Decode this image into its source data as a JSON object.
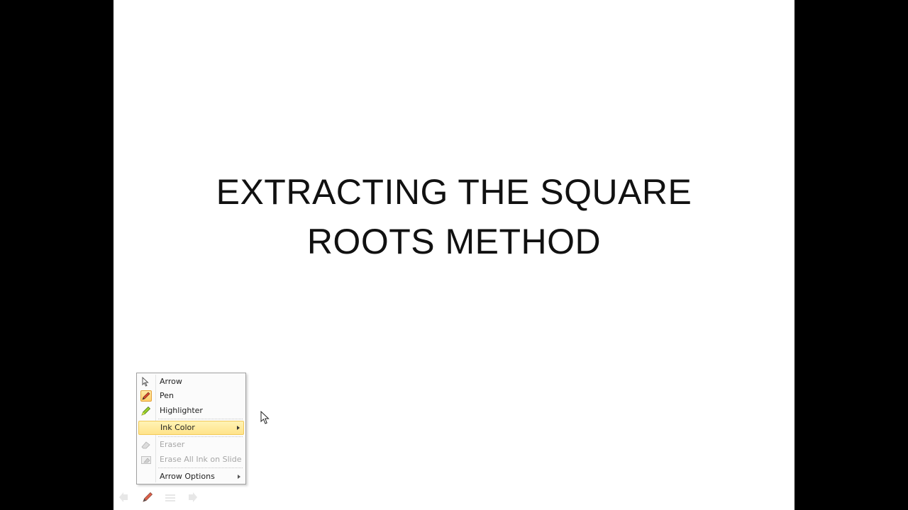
{
  "slide": {
    "title_line1": "EXTRACTING THE SQUARE",
    "title_line2": "ROOTS METHOD"
  },
  "context_menu": {
    "items": [
      {
        "label": "Arrow",
        "icon": "arrow-pointer-icon",
        "enabled": true
      },
      {
        "label": "Pen",
        "icon": "pen-icon",
        "enabled": true,
        "checked": true
      },
      {
        "label": "Highlighter",
        "icon": "highlighter-icon",
        "enabled": true
      },
      {
        "label": "Ink Color",
        "icon": null,
        "enabled": true,
        "submenu": true,
        "highlighted": true
      },
      {
        "label": "Eraser",
        "icon": "eraser-icon",
        "enabled": false
      },
      {
        "label": "Erase All Ink on Slide",
        "icon": "erase-all-icon",
        "enabled": false
      },
      {
        "label": "Arrow Options",
        "icon": null,
        "enabled": true,
        "submenu": true
      }
    ]
  },
  "toolbar": {
    "buttons": [
      "previous-arrow-icon",
      "pen-icon",
      "menu-icon",
      "next-arrow-icon"
    ]
  },
  "colors": {
    "menu_highlight": "#ffe38a",
    "pen_checked": "#ffcf6b",
    "background": "#000000",
    "slide": "#ffffff"
  }
}
